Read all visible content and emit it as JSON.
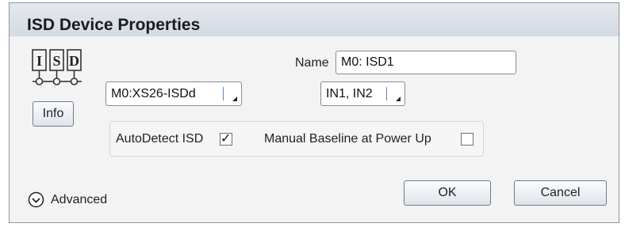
{
  "dialog": {
    "title": "ISD Device Properties"
  },
  "isd_logo": {
    "letters": [
      "I",
      "S",
      "D"
    ]
  },
  "info_button": {
    "label": "Info"
  },
  "name_field": {
    "label": "Name",
    "value": "M0: ISD1"
  },
  "device_combo": {
    "value": "M0:XS26-ISDd"
  },
  "inputs_combo": {
    "value": "IN1, IN2"
  },
  "options": {
    "autodetect": {
      "label": "AutoDetect ISD",
      "checked": true,
      "check_glyph": "✓"
    },
    "manual_baseline": {
      "label": "Manual Baseline at Power Up",
      "checked": false
    }
  },
  "advanced": {
    "label": "Advanced",
    "icon": "chevron-down-circle-icon"
  },
  "buttons": {
    "ok": "OK",
    "cancel": "Cancel"
  }
}
